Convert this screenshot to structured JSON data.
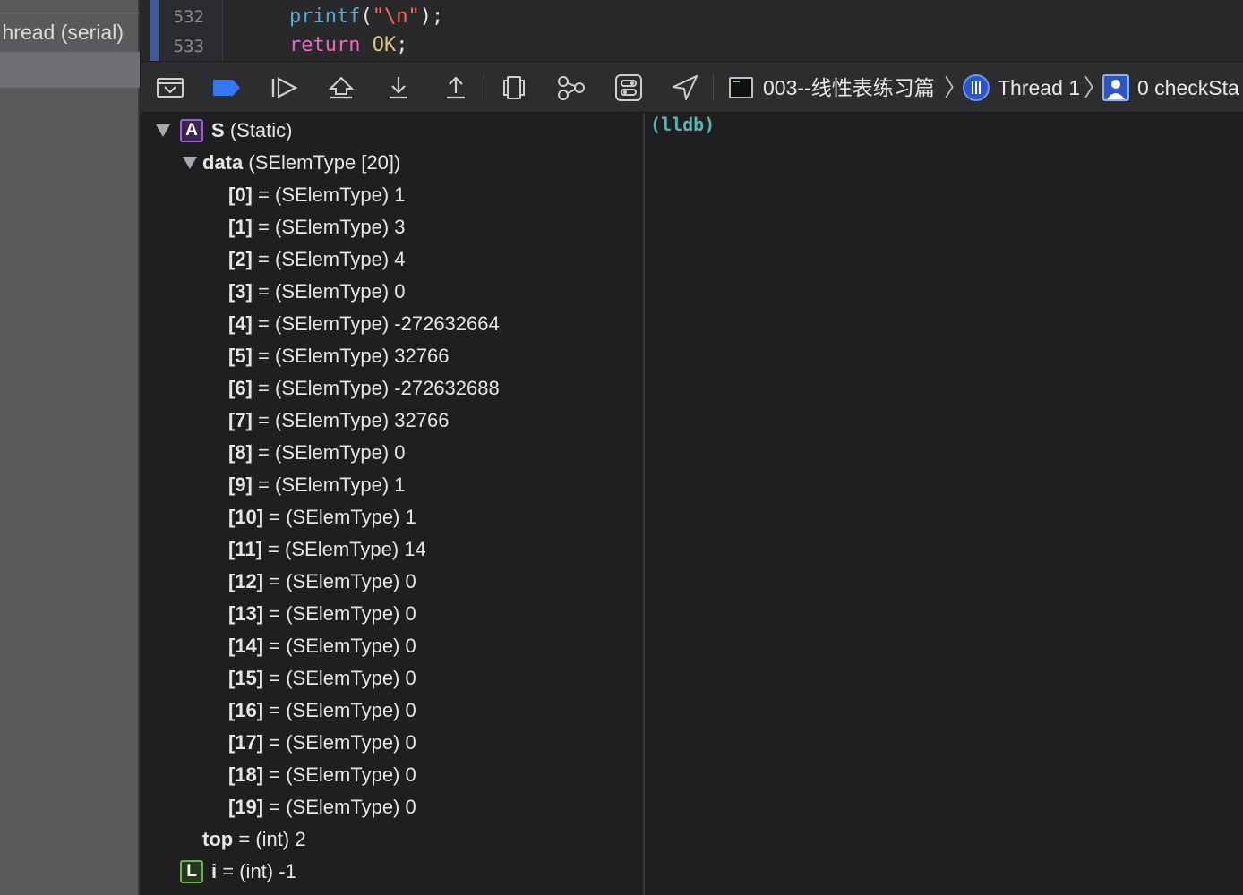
{
  "navigator": {
    "thread_label": "hread (serial)"
  },
  "editor": {
    "lines": [
      {
        "number": "532",
        "fn": "printf",
        "open": "(",
        "str": "\"\\n\"",
        "close": ");"
      },
      {
        "number": "533",
        "kw": "return",
        "space": " ",
        "const": "OK",
        "end": ";"
      }
    ]
  },
  "toolbar": {
    "buttons": [
      {
        "icon": "hide-debug-area-icon"
      },
      {
        "icon": "breakpoints-toggle-icon"
      },
      {
        "icon": "continue-icon"
      },
      {
        "icon": "step-over-icon"
      },
      {
        "icon": "step-into-icon"
      },
      {
        "icon": "step-out-icon"
      },
      {
        "icon": "view-hierarchy-icon"
      },
      {
        "icon": "memory-graph-icon"
      },
      {
        "icon": "environment-overrides-icon"
      },
      {
        "icon": "simulate-location-icon"
      }
    ],
    "breadcrumbs": {
      "target": "003--线性表练习篇",
      "thread": "Thread 1",
      "frame": "0 checkSta"
    },
    "accent_color": "#3478f6"
  },
  "variables": {
    "root": {
      "badge": "A",
      "name": "S",
      "type": "(Static)"
    },
    "data": {
      "name": "data",
      "type": "(SElemType [20])"
    },
    "elements": [
      {
        "index": "[0]",
        "eq": "=",
        "type": "(SElemType)",
        "value": "1"
      },
      {
        "index": "[1]",
        "eq": "=",
        "type": "(SElemType)",
        "value": "3"
      },
      {
        "index": "[2]",
        "eq": "=",
        "type": "(SElemType)",
        "value": "4"
      },
      {
        "index": "[3]",
        "eq": "=",
        "type": "(SElemType)",
        "value": "0"
      },
      {
        "index": "[4]",
        "eq": "=",
        "type": "(SElemType)",
        "value": "-272632664"
      },
      {
        "index": "[5]",
        "eq": "=",
        "type": "(SElemType)",
        "value": "32766"
      },
      {
        "index": "[6]",
        "eq": "=",
        "type": "(SElemType)",
        "value": "-272632688"
      },
      {
        "index": "[7]",
        "eq": "=",
        "type": "(SElemType)",
        "value": "32766"
      },
      {
        "index": "[8]",
        "eq": "=",
        "type": "(SElemType)",
        "value": "0"
      },
      {
        "index": "[9]",
        "eq": "=",
        "type": "(SElemType)",
        "value": "1"
      },
      {
        "index": "[10]",
        "eq": "=",
        "type": "(SElemType)",
        "value": "1"
      },
      {
        "index": "[11]",
        "eq": "=",
        "type": "(SElemType)",
        "value": "14"
      },
      {
        "index": "[12]",
        "eq": "=",
        "type": "(SElemType)",
        "value": "0"
      },
      {
        "index": "[13]",
        "eq": "=",
        "type": "(SElemType)",
        "value": "0"
      },
      {
        "index": "[14]",
        "eq": "=",
        "type": "(SElemType)",
        "value": "0"
      },
      {
        "index": "[15]",
        "eq": "=",
        "type": "(SElemType)",
        "value": "0"
      },
      {
        "index": "[16]",
        "eq": "=",
        "type": "(SElemType)",
        "value": "0"
      },
      {
        "index": "[17]",
        "eq": "=",
        "type": "(SElemType)",
        "value": "0"
      },
      {
        "index": "[18]",
        "eq": "=",
        "type": "(SElemType)",
        "value": "0"
      },
      {
        "index": "[19]",
        "eq": "=",
        "type": "(SElemType)",
        "value": "0"
      }
    ],
    "top": {
      "name": "top",
      "eq": "=",
      "type": "(int)",
      "value": "2"
    },
    "local": {
      "badge": "L",
      "name": "i",
      "eq": "=",
      "type": "(int)",
      "value": "-1"
    }
  },
  "console": {
    "prompt": "(lldb)"
  }
}
